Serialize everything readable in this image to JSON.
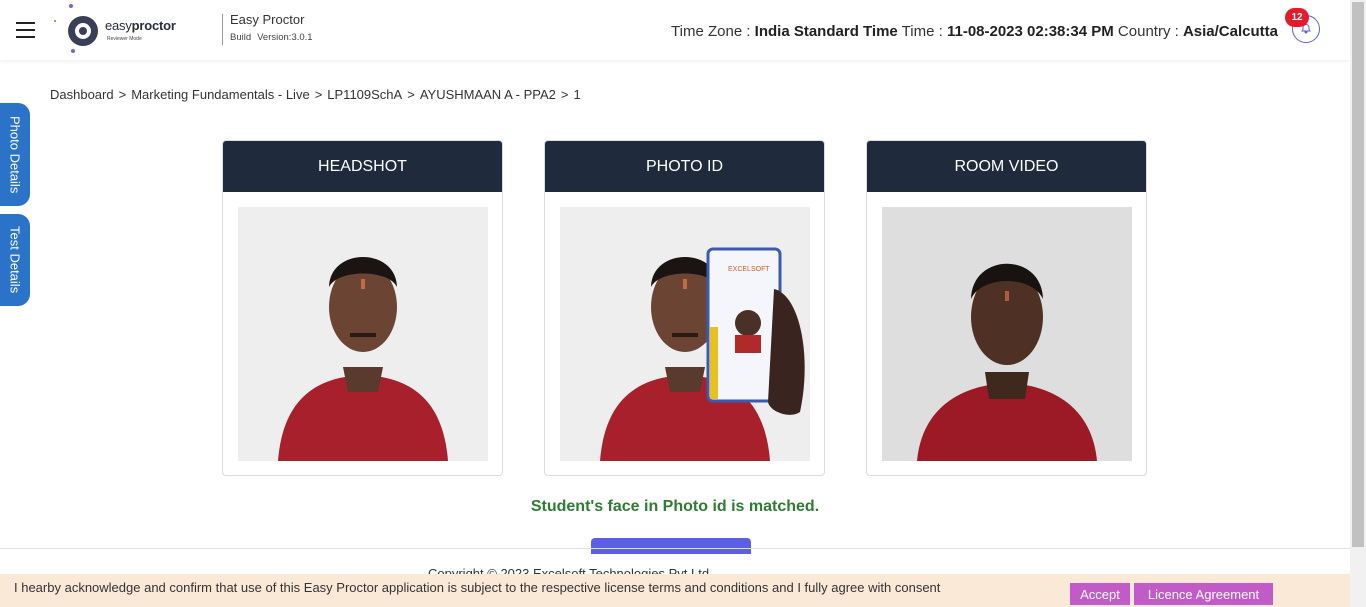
{
  "header": {
    "logo": {
      "text_light": "easy",
      "text_bold": "proctor",
      "sub": "Reviewer Mode"
    },
    "app_name": "Easy Proctor",
    "build_label": "Build",
    "version": "Version:3.0.1",
    "timezone_label": "Time Zone :",
    "timezone_value": "India Standard Time",
    "time_label": "Time :",
    "time_value": "11-08-2023 02:38:34 PM",
    "country_label": "Country :",
    "country_value": "Asia/Calcutta",
    "notification_count": "12"
  },
  "breadcrumb": [
    "Dashboard",
    "Marketing Fundamentals - Live",
    "LP1109SchA",
    "AYUSHMAAN A - PPA2",
    "1"
  ],
  "side_tabs": {
    "photo": "Photo Details",
    "test": "Test Details"
  },
  "cards": [
    {
      "title": "HEADSHOT"
    },
    {
      "title": "PHOTO ID",
      "id_card_brand": "EXCELSOFT"
    },
    {
      "title": "ROOM VIDEO"
    }
  ],
  "match_message": "Student's face in Photo id is matched.",
  "copyright": "Copyright © 2023 Excelsoft Technologies Pvt Ltd",
  "consent": {
    "text": "I hearby acknowledge and confirm that use of this Easy Proctor application is subject to the respective license terms and conditions and I fully agree with consent",
    "accept_label": "Accept",
    "licence_label": "Licence Agreement"
  },
  "colors": {
    "header_dark": "#1f2a3c",
    "side_tab": "#2a73c9",
    "match_green": "#2e7d32",
    "consent_bg": "#fbe9d8",
    "consent_btn": "#c05bc8",
    "badge": "#e31b2b",
    "accent": "#5b5fe6"
  }
}
